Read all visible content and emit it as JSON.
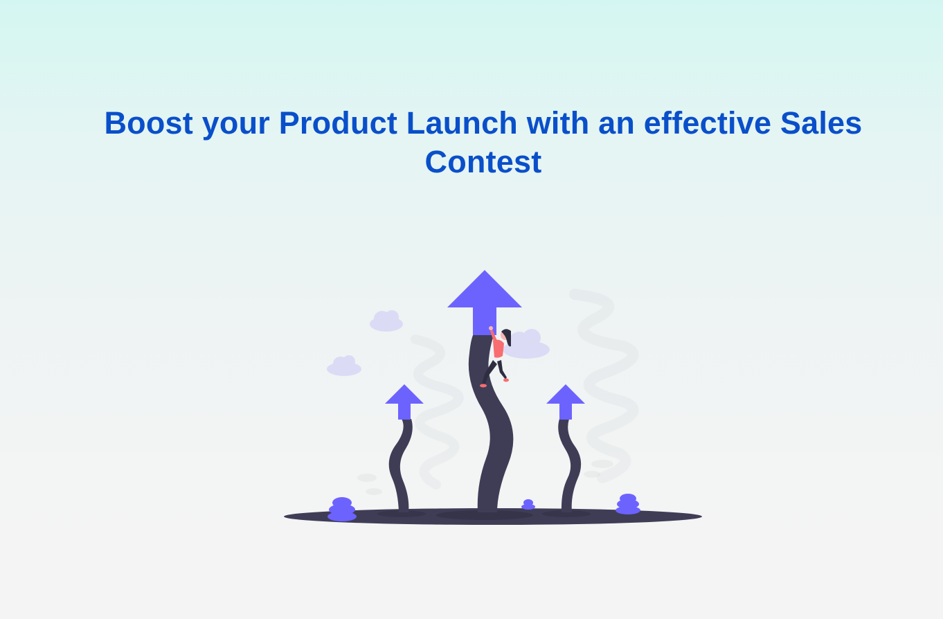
{
  "hero": {
    "headline": "Boost your Product Launch with an effective Sales Contest"
  },
  "illustration": {
    "icon": "growth-arrows-illustration",
    "colors": {
      "arrow": "#6c63ff",
      "stem": "#3f3d56",
      "cloud": "#e1e0f8",
      "shrub": "#6c63ff",
      "person_shirt": "#f86d70",
      "ground": "#3f3d56"
    }
  }
}
